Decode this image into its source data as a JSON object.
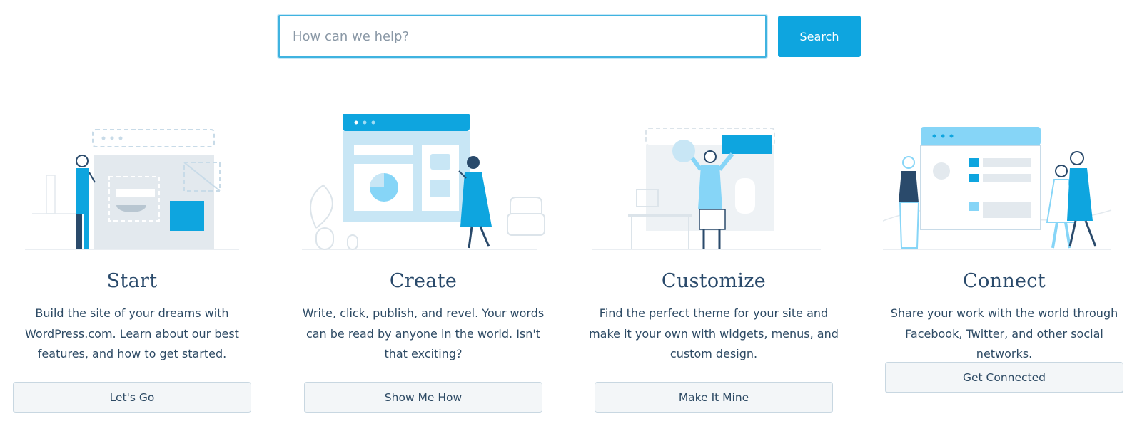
{
  "search": {
    "placeholder": "How can we help?",
    "value": "",
    "button_label": "Search"
  },
  "colors": {
    "accent": "#0ea5df",
    "light_blue": "#86d5f7",
    "pale_blue": "#c8e6f5",
    "navy": "#2a4a6b",
    "gray": "#dce4ea"
  },
  "cards": [
    {
      "title": "Start",
      "description": "Build the site of your dreams with WordPress.com. Learn about our best features, and how to get started.",
      "button_label": "Let's Go",
      "illustration": "person-building-website-illustration"
    },
    {
      "title": "Create",
      "description": "Write, click, publish, and revel. Your words can be read by anyone in the world. Isn't that exciting?",
      "button_label": "Show Me How",
      "illustration": "woman-with-website-illustration"
    },
    {
      "title": "Customize",
      "description": "Find the perfect theme for your site and make it your own with widgets, menus, and custom design.",
      "button_label": "Make It Mine",
      "illustration": "person-customizing-website-illustration"
    },
    {
      "title": "Connect",
      "description": "Share your work with the world through Facebook, Twitter, and other social networks.",
      "button_label": "Get Connected",
      "illustration": "people-connecting-illustration"
    }
  ]
}
